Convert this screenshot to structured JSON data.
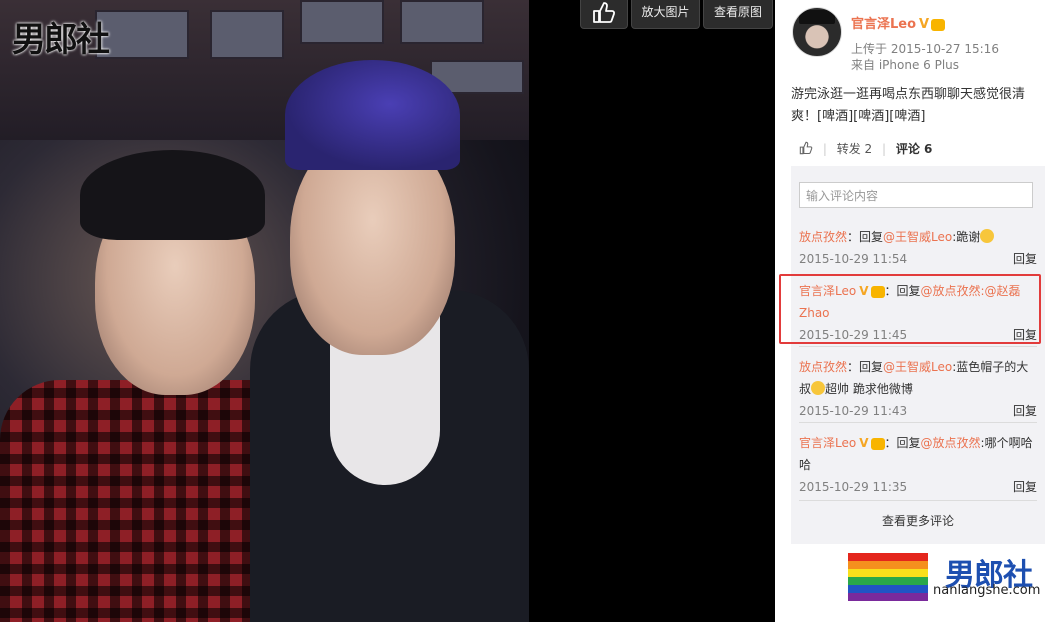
{
  "photo_watermark": "男郎社",
  "toolbar": {
    "enlarge_label": "放大图片",
    "original_label": "查看原图"
  },
  "post": {
    "username": "官言泽Leo",
    "verified_badge": "V",
    "uploaded": "上传于 2015-10-27 15:16",
    "device": "来自 iPhone 6 Plus",
    "text": "游完泳逛一逛再喝点东西聊聊天感觉很清爽！[啤酒][啤酒][啤酒]"
  },
  "actions": {
    "repost_label": "转发 2",
    "comment_label": "评论 6"
  },
  "comment_input": {
    "placeholder": "输入评论内容"
  },
  "comments": [
    {
      "name": "放点孜然",
      "prefix": "：回复",
      "at": "@王智威Leo",
      "text": ":跪谢",
      "time": "2015-10-29 11:54",
      "reply_label": "回复"
    },
    {
      "name": "官言泽Leo",
      "prefix": "：回复",
      "at": "@放点孜然:@赵磊Zhao",
      "text": "",
      "time": "2015-10-29 11:45",
      "reply_label": "回复"
    },
    {
      "name": "放点孜然",
      "prefix": "：回复",
      "at": "@王智威Leo",
      "text": ":蓝色帽子的大叔",
      "text2": "超帅  跪求他微博",
      "time": "2015-10-29 11:43",
      "reply_label": "回复"
    },
    {
      "name": "官言泽Leo",
      "prefix": "：回复",
      "at": "@放点孜然",
      "text": ":哪个啊哈哈",
      "time": "2015-10-29 11:35",
      "reply_label": "回复"
    }
  ],
  "more_comments_label": "查看更多评论",
  "bottom_watermark": {
    "logo": "男郎社",
    "url": "nanlangshe.com"
  },
  "colors": {
    "name_orange": "#eb7350",
    "highlight_red": "#e23b3b",
    "logo_blue": "#1d4fb0"
  }
}
